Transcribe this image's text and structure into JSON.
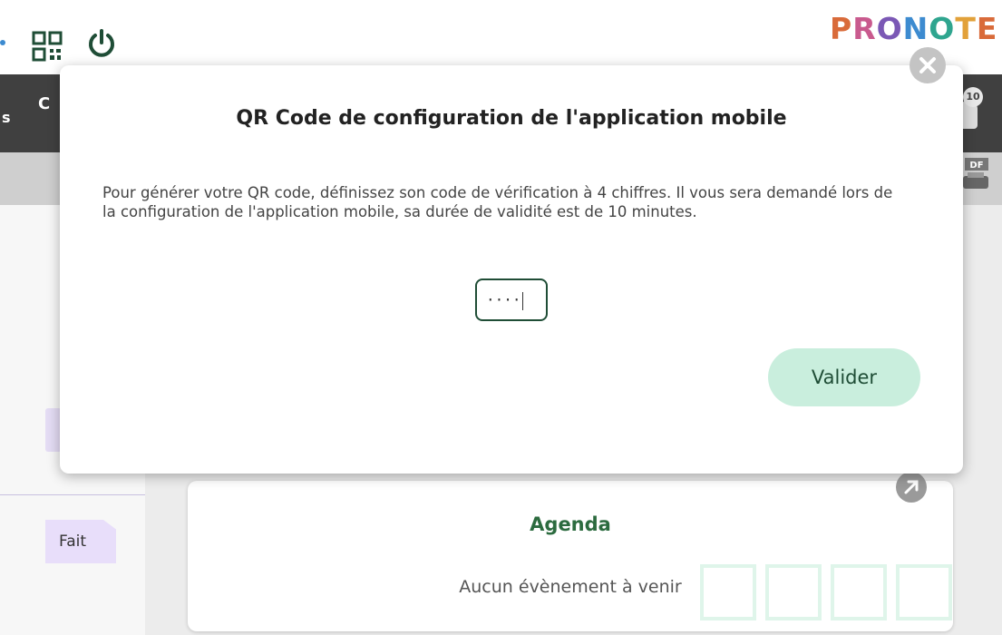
{
  "header": {
    "logo_text": "PRONOTE",
    "logo_letters": [
      {
        "char": "P",
        "color": "#d96b3a"
      },
      {
        "char": "R",
        "color": "#c95a8e"
      },
      {
        "char": "O",
        "color": "#7b58b5"
      },
      {
        "char": "N",
        "color": "#3d8bd0"
      },
      {
        "char": "O",
        "color": "#2fa58f"
      },
      {
        "char": "T",
        "color": "#e2a13a"
      },
      {
        "char": "E",
        "color": "#d96b3a"
      }
    ],
    "icons": [
      "qr-code-icon",
      "power-icon"
    ]
  },
  "nav": {
    "partial_label": "C",
    "partial_left_label": "s",
    "notification_count": "10"
  },
  "modal": {
    "title": "QR Code de configuration de l'application mobile",
    "description": "Pour générer votre QR code, définissez son code de vérification à 4 chiffres. Il vous sera demandé lors de la configuration de l'application mobile, sa durée de validité est de 10 minutes.",
    "code_value": "····",
    "validate_label": "Valider",
    "close_icon": "close-icon"
  },
  "left_panel": {
    "status_chip": "Fait"
  },
  "agenda": {
    "title": "Agenda",
    "empty_message": "Aucun évènement à venir"
  },
  "colors": {
    "brand_green": "#2c6b3f",
    "button_bg": "#c9eedd",
    "nav_bg": "#404040"
  }
}
